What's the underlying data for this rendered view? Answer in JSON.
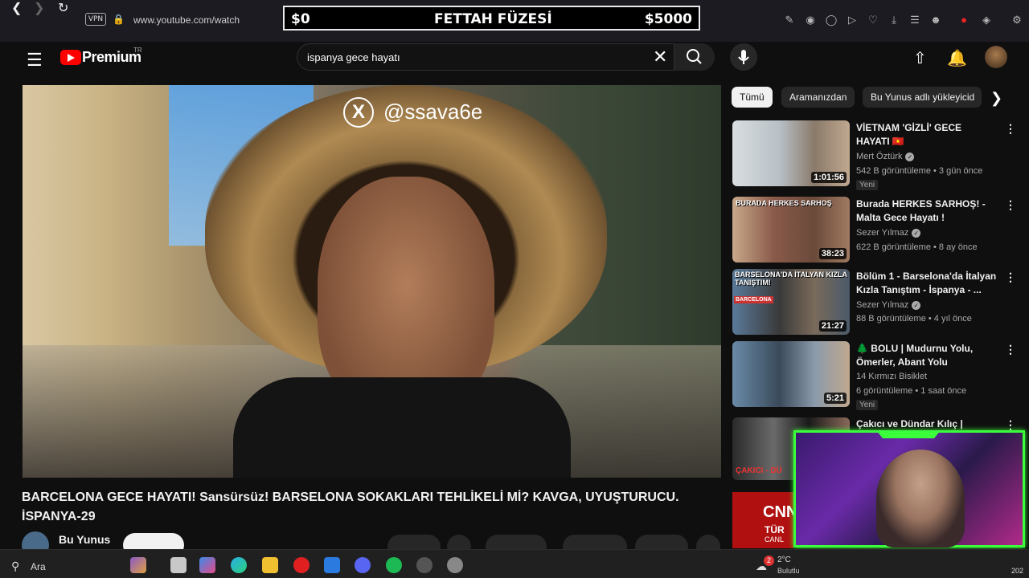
{
  "browser": {
    "vpn_label": "VPN",
    "url": "www.youtube.com/watch"
  },
  "stream_banner": {
    "left_amount": "$0",
    "title": "FETTAH FÜZESİ",
    "right_amount": "$5000"
  },
  "youtube": {
    "logo_text": "Premium",
    "logo_region": "TR",
    "search": {
      "value": "ispanya gece hayatı"
    }
  },
  "video": {
    "watermark": "@ssava6e",
    "title": "BARCELONA GECE HAYATI! Sansürsüz! BARSELONA SOKAKLARI TEHLİKELİ Mİ? KAVGA, UYUŞTURUCU. İSPANYA-29",
    "channel_name": "Bu Yunus"
  },
  "chips": [
    "Tümü",
    "Aramanızdan",
    "Bu Yunus adlı yükleyicid"
  ],
  "recommendations": [
    {
      "title": "VİETNAM 'GİZLİ' GECE HAYATI 🇻🇳",
      "channel": "Mert Öztürk",
      "meta": "542 B görüntüleme • 3 gün önce",
      "badge": "Yeni",
      "duration": "1:01:56",
      "color": "#c9d1d6"
    },
    {
      "title": "Burada HERKES SARHOŞ! - Malta Gece Hayatı !",
      "channel": "Sezer Yılmaz",
      "meta": "622 B görüntüleme • 8 ay önce",
      "badge": "",
      "duration": "38:23",
      "color": "#7a5a4a"
    },
    {
      "title": "Bölüm 1 - Barselona'da İtalyan Kızla Tanıştım - İspanya - ...",
      "channel": "Sezer Yılmaz",
      "meta": "88 B görüntüleme • 4 yıl önce",
      "badge": "",
      "duration": "21:27",
      "color": "#4a6a8a"
    },
    {
      "title": "🌲 BOLU | Mudurnu Yolu, Ömerler, Abant Yolu",
      "channel": "14 Kırmızı Bisiklet",
      "meta": "6 görüntüleme • 1 saat önce",
      "badge": "Yeni",
      "duration": "5:21",
      "color": "#5a6a7a"
    },
    {
      "title": "Çakıcı ve Dündar Kılıç |",
      "channel": "",
      "meta": "",
      "badge": "",
      "duration": "",
      "color": "#2a2a2a"
    }
  ],
  "thumbnail_texts": {
    "burada": "BURADA HERKES SARHOŞ",
    "barcelona": "BARSELONA'DA İTALYAN KIZLA TANIŞTIM!",
    "barcelona_tag": "BARCELONA",
    "cakici": "ÇAKICI - DÜ"
  },
  "cnn": {
    "logo": "CNN",
    "sub": "TÜR",
    "sub2": "CANL"
  },
  "taskbar": {
    "search_label": "Ara",
    "weather_temp": "2°C",
    "weather_desc": "Bulutlu",
    "notif_count": "2",
    "clock": "202"
  },
  "colors": {
    "yt_red": "#ff0000",
    "cam_border": "#3cff3c",
    "bg": "#0f0f0f"
  }
}
